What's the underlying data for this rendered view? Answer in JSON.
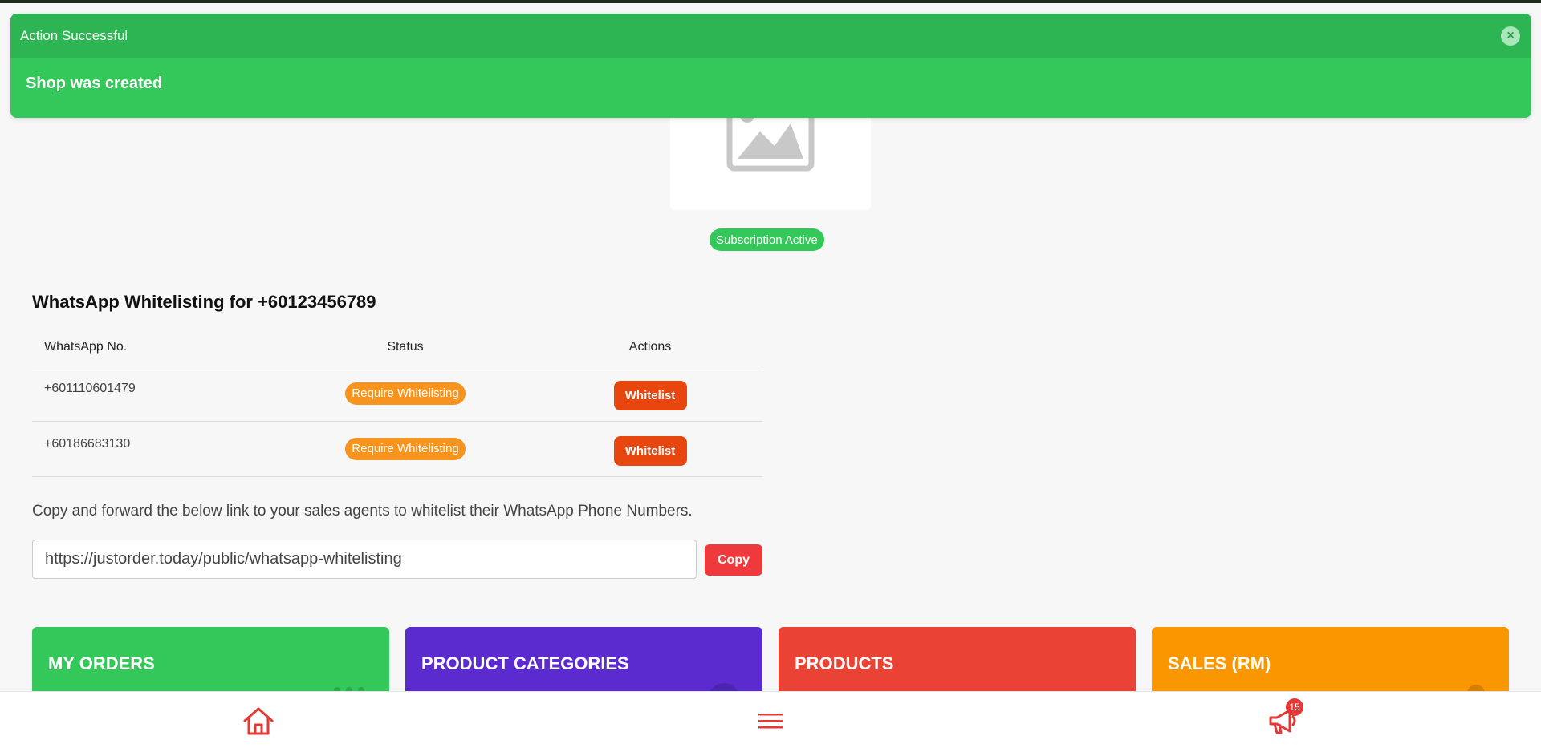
{
  "toast": {
    "title": "Action Successful",
    "message": "Shop was created",
    "close_icon": "close-icon",
    "color": "#34c759"
  },
  "shop": {
    "logo_icon": "image-placeholder-icon",
    "subscription_badge": "Subscription Active"
  },
  "whitelist": {
    "title": "WhatsApp Whitelisting for +60123456789",
    "columns": [
      "WhatsApp No.",
      "Status",
      "Actions"
    ],
    "rows": [
      {
        "number": "+601110601479",
        "status": "Require Whitelisting",
        "action": "Whitelist"
      },
      {
        "number": "+60186683130",
        "status": "Require Whitelisting",
        "action": "Whitelist"
      }
    ],
    "status_color": "#f7941d",
    "action_color": "#e8460f"
  },
  "share": {
    "hint": "Copy and forward the below link to your sales agents to whitelist their WhatsApp Phone Numbers.",
    "link": "https://justorder.today/public/whatsapp-whitelisting",
    "copy_label": "Copy"
  },
  "cards": [
    {
      "label": "MY ORDERS",
      "color": "#34c759"
    },
    {
      "label": "PRODUCT CATEGORIES",
      "color": "#5b2bd0"
    },
    {
      "label": "PRODUCTS",
      "color": "#ea4335"
    },
    {
      "label": "SALES (RM)",
      "color": "#fa9600"
    }
  ],
  "bottom_nav": {
    "home_icon": "home-icon",
    "menu_icon": "menu-icon",
    "announcement_icon": "megaphone-icon",
    "notification_count": "15"
  }
}
